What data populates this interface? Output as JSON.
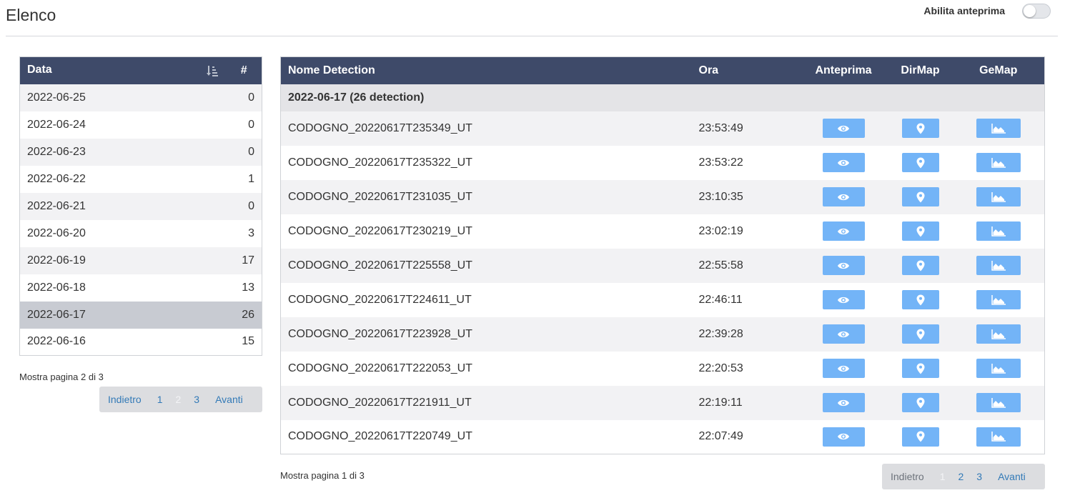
{
  "header": {
    "title": "Elenco",
    "preview_toggle_label": "Abilita anteprima",
    "preview_enabled": false
  },
  "dates_table": {
    "columns": [
      "Data",
      "#"
    ],
    "rows": [
      {
        "date": "2022-06-25",
        "count": "0"
      },
      {
        "date": "2022-06-24",
        "count": "0"
      },
      {
        "date": "2022-06-23",
        "count": "0"
      },
      {
        "date": "2022-06-22",
        "count": "1"
      },
      {
        "date": "2022-06-21",
        "count": "0"
      },
      {
        "date": "2022-06-20",
        "count": "3"
      },
      {
        "date": "2022-06-19",
        "count": "17"
      },
      {
        "date": "2022-06-18",
        "count": "13"
      },
      {
        "date": "2022-06-17",
        "count": "26"
      },
      {
        "date": "2022-06-16",
        "count": "15"
      }
    ],
    "selected": "2022-06-17",
    "page_info": "Mostra pagina 2 di 3",
    "pagination": {
      "prev": "Indietro",
      "pages": [
        "1",
        "2",
        "3"
      ],
      "current": "2",
      "next": "Avanti"
    }
  },
  "detections_table": {
    "columns": [
      "Nome Detection",
      "Ora",
      "Anteprima",
      "DirMap",
      "GeMap"
    ],
    "group_label": "2022-06-17 (26 detection)",
    "rows": [
      {
        "name": "CODOGNO_20220617T235349_UT",
        "time": "23:53:49"
      },
      {
        "name": "CODOGNO_20220617T235322_UT",
        "time": "23:53:22"
      },
      {
        "name": "CODOGNO_20220617T231035_UT",
        "time": "23:10:35"
      },
      {
        "name": "CODOGNO_20220617T230219_UT",
        "time": "23:02:19"
      },
      {
        "name": "CODOGNO_20220617T225558_UT",
        "time": "22:55:58"
      },
      {
        "name": "CODOGNO_20220617T224611_UT",
        "time": "22:46:11"
      },
      {
        "name": "CODOGNO_20220617T223928_UT",
        "time": "22:39:28"
      },
      {
        "name": "CODOGNO_20220617T222053_UT",
        "time": "22:20:53"
      },
      {
        "name": "CODOGNO_20220617T221911_UT",
        "time": "22:19:11"
      },
      {
        "name": "CODOGNO_20220617T220749_UT",
        "time": "22:07:49"
      }
    ],
    "page_info": "Mostra pagina 1 di 3",
    "pagination": {
      "prev": "Indietro",
      "pages": [
        "1",
        "2",
        "3"
      ],
      "current": "1",
      "next": "Avanti"
    }
  },
  "icons": {
    "sort": "sort-amount-icon",
    "preview": "eye-icon",
    "dirmap": "map-marker-icon",
    "gemap": "area-chart-icon"
  },
  "colors": {
    "header_bg": "#3e4a69",
    "button_bg": "#73b4f7",
    "selected_row": "#c8cbd2",
    "link": "#337ab7"
  }
}
